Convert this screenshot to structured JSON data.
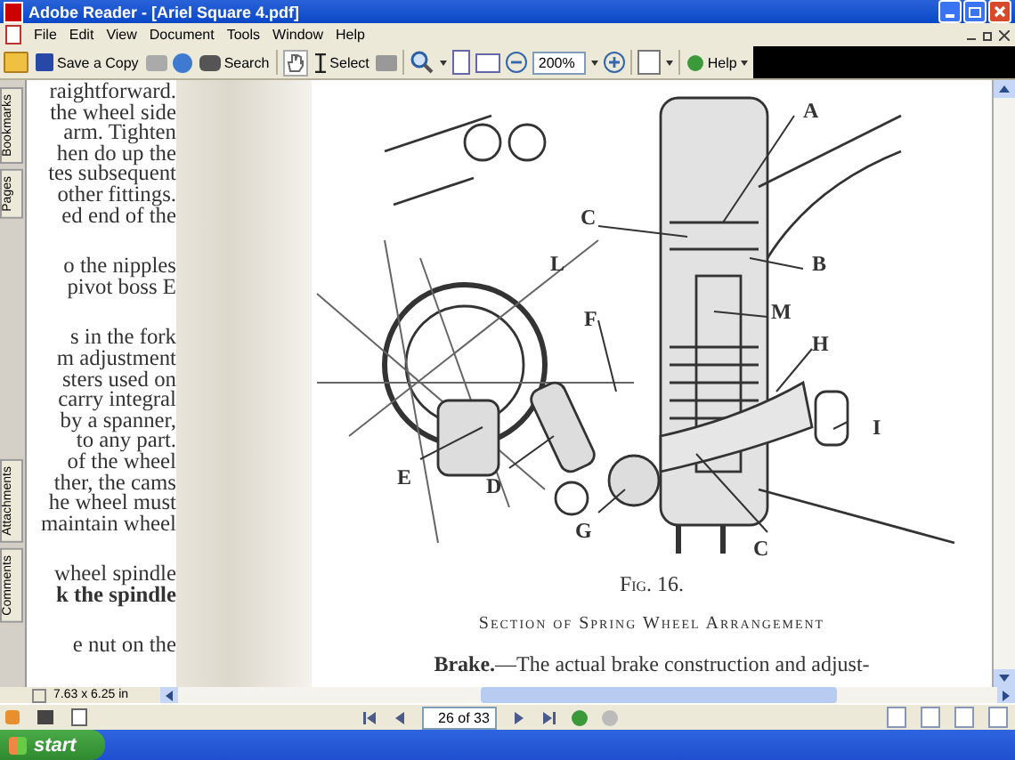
{
  "window": {
    "title": "Adobe Reader - [Ariel Square 4.pdf]"
  },
  "menu": [
    "File",
    "Edit",
    "View",
    "Document",
    "Tools",
    "Window",
    "Help"
  ],
  "toolbar": {
    "save_copy": "Save a Copy",
    "search": "Search",
    "select": "Select",
    "zoom": "200%",
    "help": "Help"
  },
  "nav_tabs": [
    {
      "label": "Bookmarks"
    },
    {
      "label": "Pages"
    },
    {
      "label": "Attachments"
    },
    {
      "label": "Comments"
    }
  ],
  "page": {
    "paragraphs": [
      {
        "lines": [
          {
            "text": "raightforward.",
            "bold": false
          },
          {
            "text": "the wheel side",
            "bold": false
          },
          {
            "text": "arm.  Tighten",
            "bold": false
          },
          {
            "text": "hen do up the",
            "bold": false
          },
          {
            "text": "tes subsequent",
            "bold": false
          },
          {
            "text": "other fittings.",
            "bold": false
          },
          {
            "text": "ed end of the",
            "bold": false
          }
        ]
      },
      {
        "lines": [
          {
            "text": "o the nipples",
            "bold": false
          },
          {
            "text": "pivot boss E",
            "bold": false
          }
        ]
      },
      {
        "lines": [
          {
            "text": "s in the fork",
            "bold": false
          },
          {
            "text": "m adjustment",
            "bold": false
          },
          {
            "text": "sters used on",
            "bold": false
          },
          {
            "text": "carry integral",
            "bold": false
          },
          {
            "text": "by a spanner,",
            "bold": false
          },
          {
            "text": "to any part.",
            "bold": false
          },
          {
            "text": "of the wheel",
            "bold": false
          },
          {
            "text": "ther, the cams",
            "bold": false
          },
          {
            "text": "he wheel must",
            "bold": false
          },
          {
            "text": "maintain wheel",
            "bold": false
          }
        ]
      },
      {
        "lines": [
          {
            "text": "wheel spindle",
            "bold": false
          },
          {
            "text": "k the spindle",
            "bold": true
          }
        ]
      },
      {
        "lines": [
          {
            "text": "e nut on the",
            "bold": false
          }
        ]
      }
    ],
    "figure": {
      "labels": [
        "A",
        "C",
        "B",
        "L",
        "M",
        "F",
        "H",
        "I",
        "E",
        "D",
        "G",
        "C"
      ]
    },
    "caption": "Fig. 16.",
    "subcaption": "Section of Spring Wheel Arrangement",
    "body": "**Brake.**—The actual brake construction and adjust-"
  },
  "page_size": "7.63 x 6.25 in",
  "page_field": "26 of 33",
  "taskbar": {
    "start": "start"
  }
}
